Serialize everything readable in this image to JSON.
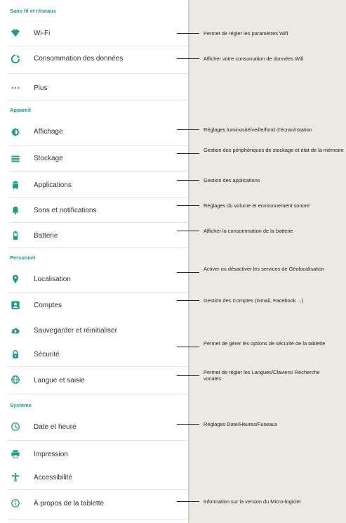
{
  "sections": {
    "wireless": "Sans fil et réseaux",
    "device": "Appareil",
    "personal": "Personnel",
    "system": "Système"
  },
  "items": {
    "wifi": "Wi-Fi",
    "data_usage": "Consommation des données",
    "more": "Plus",
    "display": "Affichage",
    "storage": "Stockage",
    "apps": "Applications",
    "sound": "Sons et notifications",
    "battery": "Batterie",
    "location": "Localisation",
    "accounts": "Comptes",
    "backup": "Sauvegarder et réinitialiser",
    "security": "Sécurité",
    "language": "Langue et saisie",
    "datetime": "Date et heure",
    "printing": "Impression",
    "accessibility": "Accessibilité",
    "about": "À propos de la tablette"
  },
  "annotations": {
    "wifi": "Permet de régler les paramètres Wifi",
    "data_usage": "Afficher votre consomation de données Wifi",
    "display": "Réglages luminosité/veille/fond d’écran/rotation",
    "storage": "Gestion des périphériques de stockage et état de la mémoire",
    "apps": "Gestion des applications",
    "sound": "Réglages du volume et environnement sonore",
    "battery": "Afficher la consommation de la batterie",
    "location": "Activer ou désactiver les services de Géolocalisation",
    "accounts": "Gestion des Comptes (Gmail, Facebook ...)",
    "security": "Permet de gérer les options de sécurité de la tablette",
    "language": "Permet de régler les Langues/Claviers/ Recherche vocales",
    "datetime": "Réglages Date/Heures/Fuseaux",
    "about": "Information sur la version du Micro-logiciel"
  },
  "colors": {
    "accent": "#1f9a8c",
    "icon": "#1f9a8c",
    "panel": "#ffffff",
    "background": "#ece9e3"
  }
}
